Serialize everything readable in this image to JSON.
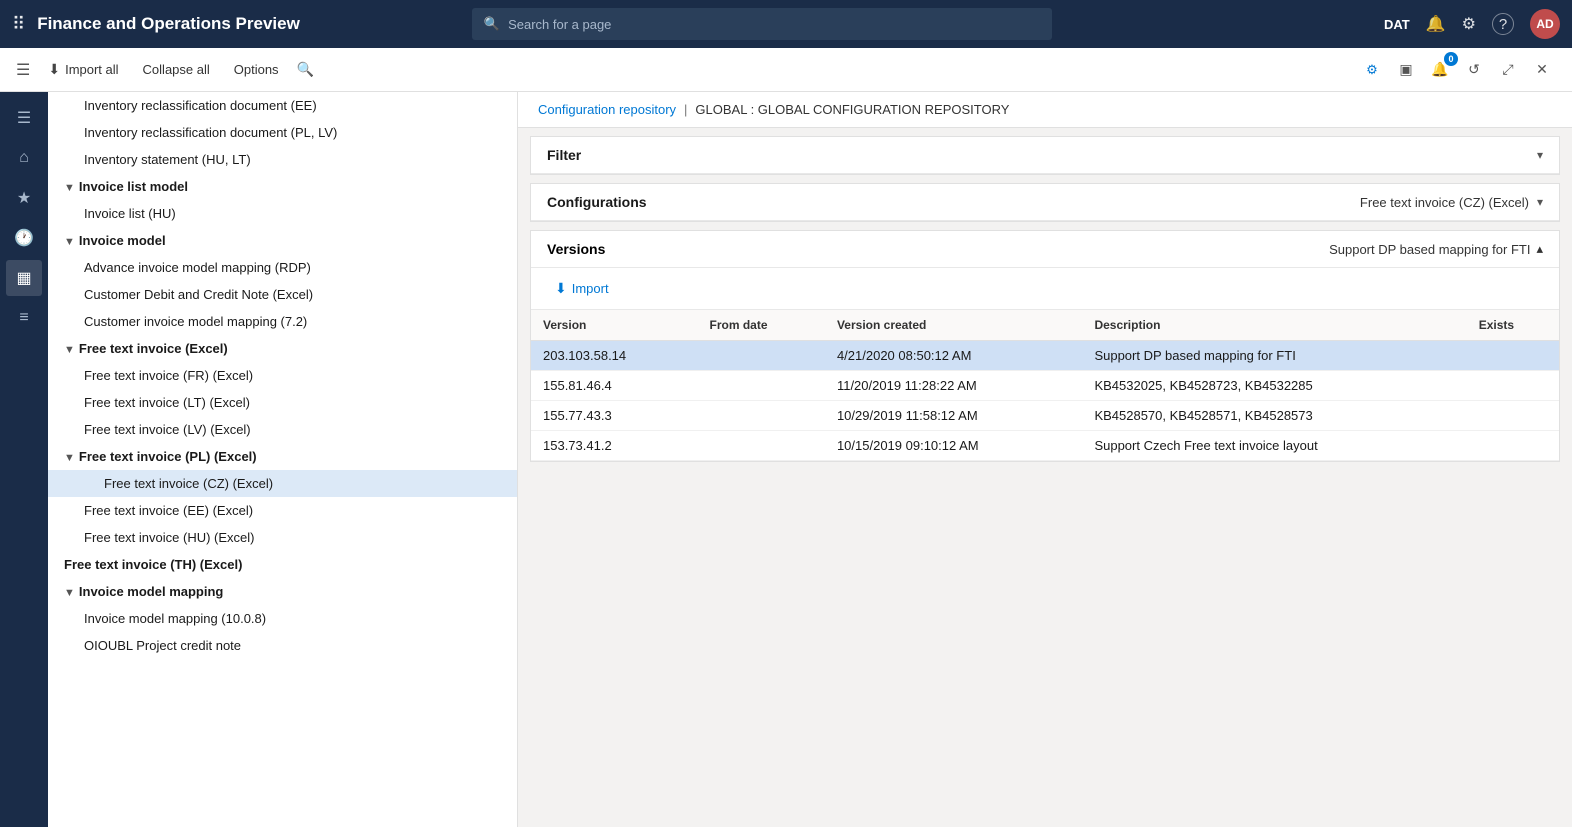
{
  "app": {
    "title": "Finance and Operations Preview",
    "env": "DAT"
  },
  "search": {
    "placeholder": "Search for a page"
  },
  "toolbar": {
    "import_all": "Import all",
    "collapse_all": "Collapse all",
    "options": "Options"
  },
  "breadcrumb": {
    "parent": "Configuration repository",
    "separator": "|",
    "current": "GLOBAL : GLOBAL CONFIGURATION REPOSITORY"
  },
  "filter_section": {
    "title": "Filter",
    "collapsed": true
  },
  "configurations_section": {
    "title": "Configurations",
    "selected_config": "Free text invoice (CZ) (Excel)"
  },
  "versions_section": {
    "title": "Versions",
    "selected_version_label": "Support DP based mapping for FTI",
    "import_btn": "Import",
    "columns": [
      "Version",
      "From date",
      "Version created",
      "Description",
      "Exists"
    ],
    "rows": [
      {
        "version": "203.103.58.14",
        "from_date": "",
        "version_created": "4/21/2020 08:50:12 AM",
        "description": "Support DP based mapping for FTI",
        "exists": "",
        "selected": true
      },
      {
        "version": "155.81.46.4",
        "from_date": "",
        "version_created": "11/20/2019 11:28:22 AM",
        "description": "KB4532025, KB4528723, KB4532285",
        "exists": "",
        "selected": false
      },
      {
        "version": "155.77.43.3",
        "from_date": "",
        "version_created": "10/29/2019 11:58:12 AM",
        "description": "KB4528570, KB4528571, KB4528573",
        "exists": "",
        "selected": false
      },
      {
        "version": "153.73.41.2",
        "from_date": "",
        "version_created": "10/15/2019 09:10:12 AM",
        "description": "Support Czech Free text invoice layout",
        "exists": "",
        "selected": false
      }
    ]
  },
  "tree": {
    "items": [
      {
        "level": 1,
        "label": "Inventory reclassification document (EE)",
        "hasChildren": false,
        "expanded": false
      },
      {
        "level": 1,
        "label": "Inventory reclassification document (PL, LV)",
        "hasChildren": false,
        "expanded": false
      },
      {
        "level": 1,
        "label": "Inventory statement (HU, LT)",
        "hasChildren": false,
        "expanded": false
      },
      {
        "level": 0,
        "label": "Invoice list model",
        "hasChildren": true,
        "expanded": true
      },
      {
        "level": 1,
        "label": "Invoice list (HU)",
        "hasChildren": false,
        "expanded": false
      },
      {
        "level": 0,
        "label": "Invoice model",
        "hasChildren": true,
        "expanded": true
      },
      {
        "level": 1,
        "label": "Advance invoice model mapping (RDP)",
        "hasChildren": false,
        "expanded": false
      },
      {
        "level": 1,
        "label": "Customer Debit and Credit Note (Excel)",
        "hasChildren": false,
        "expanded": false
      },
      {
        "level": 1,
        "label": "Customer invoice model mapping (7.2)",
        "hasChildren": false,
        "expanded": false
      },
      {
        "level": 0,
        "label": "Free text invoice (Excel)",
        "hasChildren": true,
        "expanded": true
      },
      {
        "level": 1,
        "label": "Free text invoice (FR) (Excel)",
        "hasChildren": false,
        "expanded": false
      },
      {
        "level": 1,
        "label": "Free text invoice (LT) (Excel)",
        "hasChildren": false,
        "expanded": false
      },
      {
        "level": 1,
        "label": "Free text invoice (LV) (Excel)",
        "hasChildren": false,
        "expanded": false
      },
      {
        "level": 0,
        "label": "Free text invoice (PL) (Excel)",
        "hasChildren": true,
        "expanded": true
      },
      {
        "level": 2,
        "label": "Free text invoice (CZ) (Excel)",
        "hasChildren": false,
        "expanded": false,
        "selected": true
      },
      {
        "level": 1,
        "label": "Free text invoice (EE) (Excel)",
        "hasChildren": false,
        "expanded": false
      },
      {
        "level": 1,
        "label": "Free text invoice (HU) (Excel)",
        "hasChildren": false,
        "expanded": false
      },
      {
        "level": 0,
        "label": "Free text invoice (TH) (Excel)",
        "hasChildren": false,
        "expanded": false
      },
      {
        "level": 0,
        "label": "Invoice model mapping",
        "hasChildren": true,
        "expanded": true
      },
      {
        "level": 1,
        "label": "Invoice model mapping (10.0.8)",
        "hasChildren": false,
        "expanded": false
      },
      {
        "level": 1,
        "label": "OIOUBL Project credit note",
        "hasChildren": false,
        "expanded": false
      }
    ]
  },
  "sidebar_icons": [
    {
      "name": "menu-icon",
      "icon": "☰",
      "active": false
    },
    {
      "name": "home-icon",
      "icon": "⌂",
      "active": false
    },
    {
      "name": "favorite-icon",
      "icon": "★",
      "active": false
    },
    {
      "name": "recent-icon",
      "icon": "🕐",
      "active": false
    },
    {
      "name": "list-icon",
      "icon": "▦",
      "active": true
    },
    {
      "name": "report-icon",
      "icon": "≡",
      "active": false
    }
  ],
  "toolbar_right_icons": [
    {
      "name": "settings-icon",
      "icon": "⚙",
      "badge": null
    },
    {
      "name": "layout-icon",
      "icon": "▣",
      "badge": null
    },
    {
      "name": "notification-icon",
      "icon": "🔔",
      "badge": "0"
    },
    {
      "name": "refresh-icon",
      "icon": "↺",
      "badge": null
    },
    {
      "name": "expand-icon",
      "icon": "⤢",
      "badge": null
    },
    {
      "name": "close-icon",
      "icon": "✕",
      "badge": null
    }
  ],
  "top_right_icons": [
    {
      "name": "bell-icon",
      "icon": "🔔"
    },
    {
      "name": "gear-icon",
      "icon": "⚙"
    },
    {
      "name": "help-icon",
      "icon": "?"
    }
  ],
  "avatar": {
    "initials": "AD"
  }
}
